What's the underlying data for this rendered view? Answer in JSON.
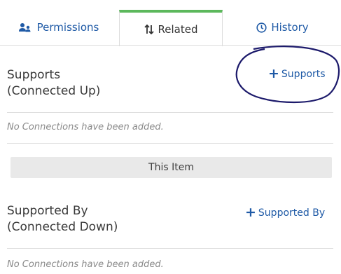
{
  "tabs": {
    "permissions": {
      "label": "Permissions",
      "icon": "users-icon"
    },
    "related": {
      "label": "Related",
      "icon": "sort-arrows-icon",
      "active": true
    },
    "history": {
      "label": "History",
      "icon": "clock-icon"
    }
  },
  "supports": {
    "title_line1": "Supports",
    "title_line2": "(Connected Up)",
    "add_label": "Supports",
    "empty_text": "No Connections have been added."
  },
  "this_item": {
    "label": "This Item"
  },
  "supported_by": {
    "title_line1": "Supported By",
    "title_line2": "(Connected Down)",
    "add_label": "Supported By",
    "empty_text": "No Connections have been added."
  },
  "colors": {
    "link": "#1f5aa6",
    "active_tab_border": "#5cb85c",
    "annotation_ink": "#1c1a6b"
  }
}
